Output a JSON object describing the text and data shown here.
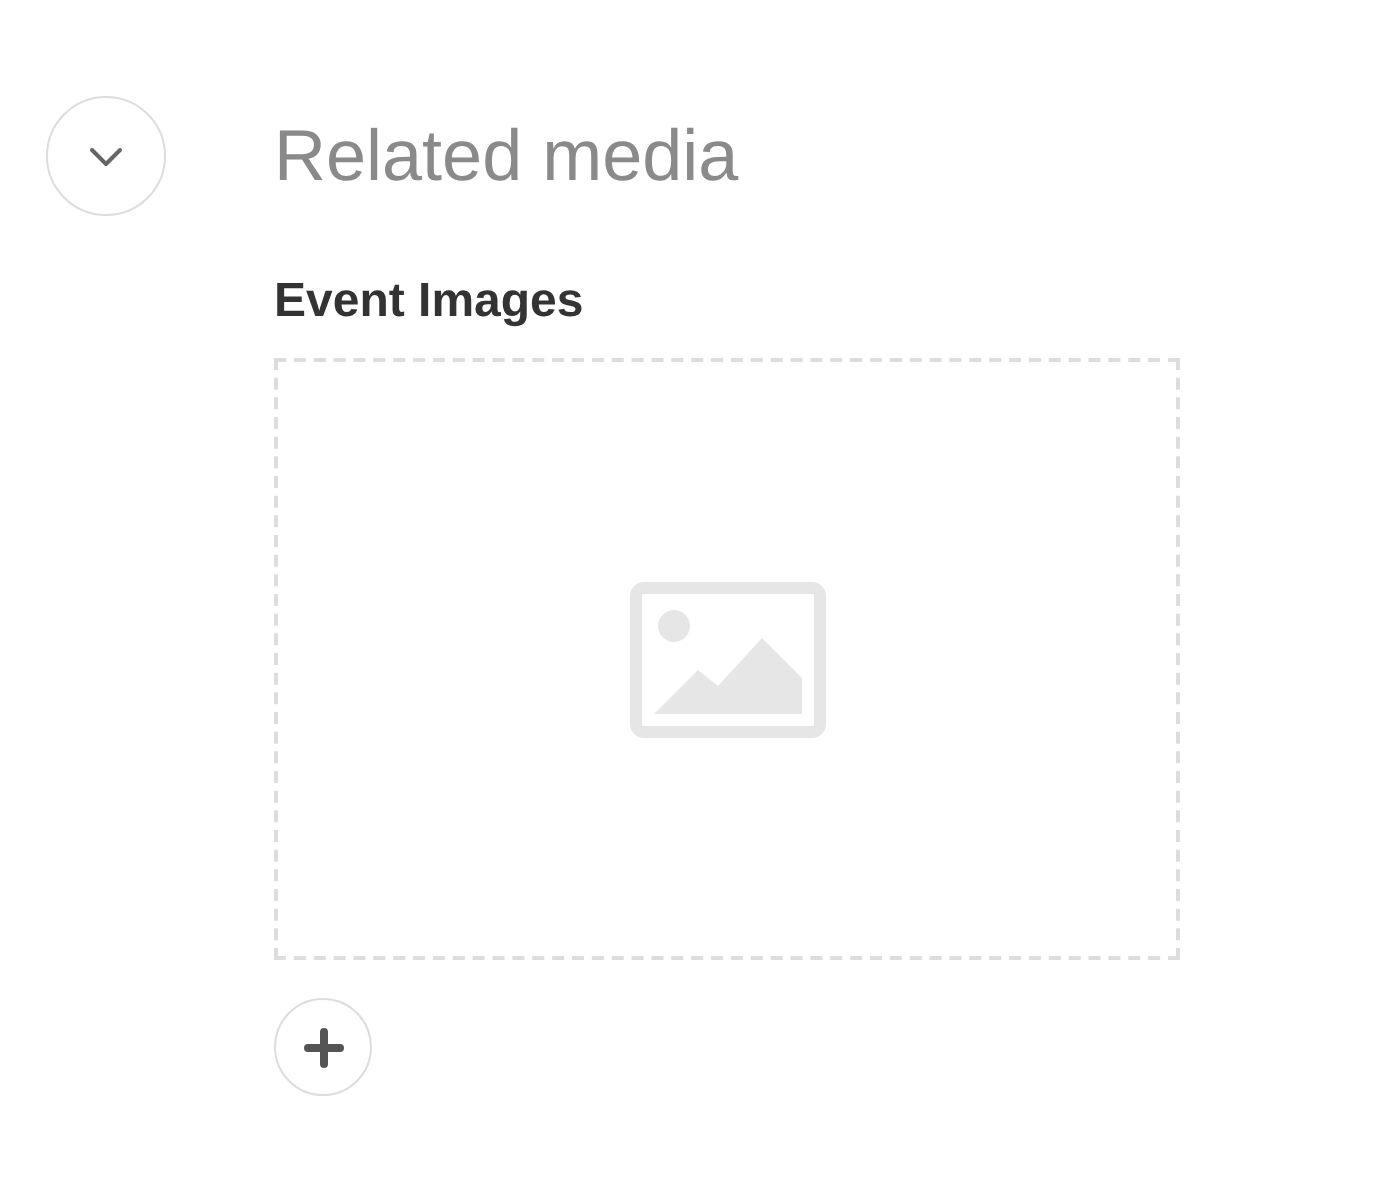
{
  "section": {
    "title": "Related media"
  },
  "field": {
    "label": "Event Images"
  }
}
